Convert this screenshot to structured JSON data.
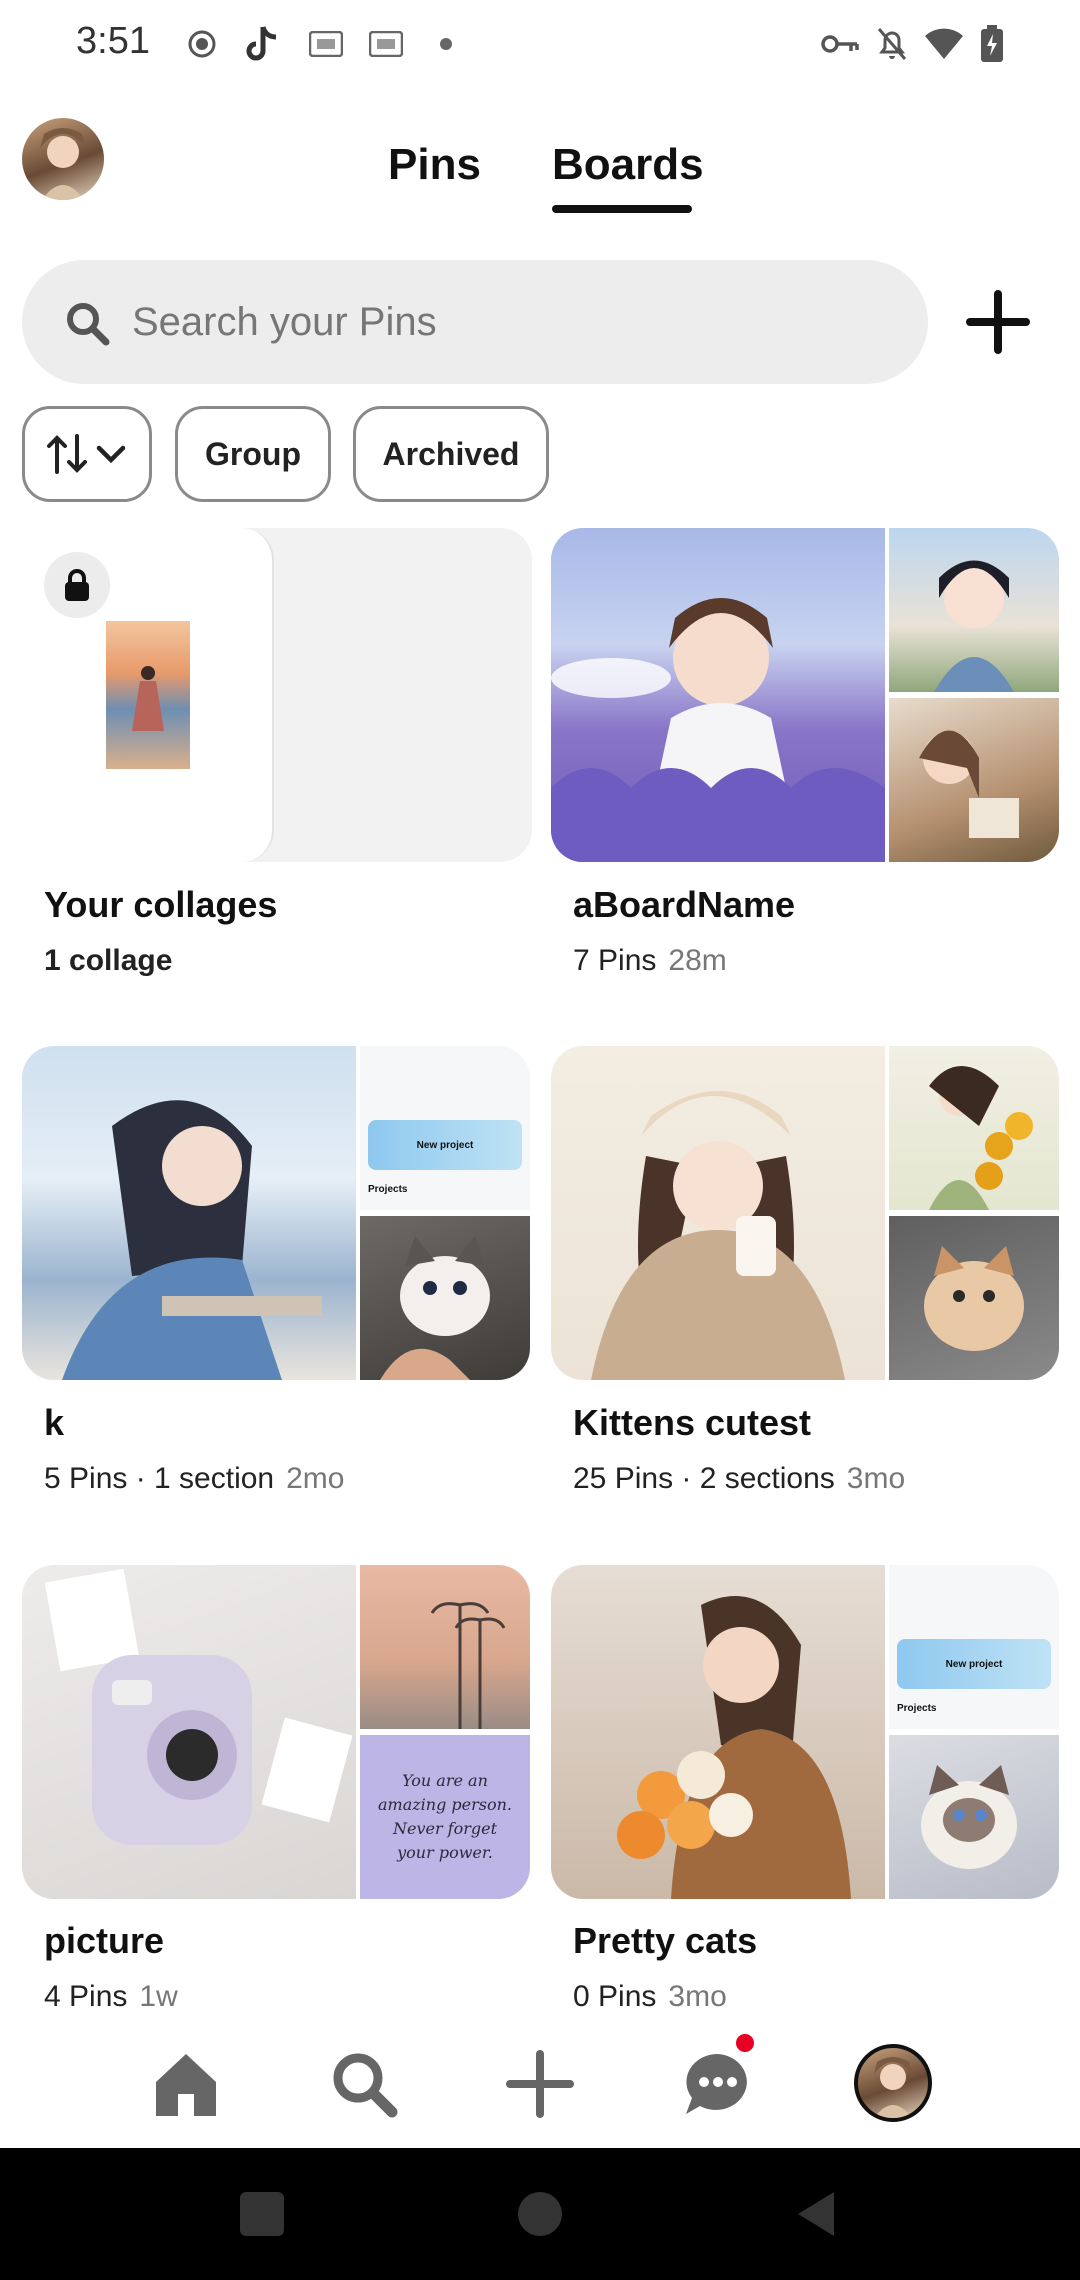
{
  "status_bar": {
    "time": "3:51",
    "left_icons": [
      "record-icon",
      "tiktok-icon",
      "iqiyi-icon",
      "iqiyi-icon",
      "dot-icon"
    ],
    "right_icons": [
      "vpn-key-icon",
      "bell-off-icon",
      "wifi-icon",
      "battery-charging-icon"
    ]
  },
  "header": {
    "tabs": [
      {
        "label": "Pins",
        "active": false
      },
      {
        "label": "Boards",
        "active": true
      }
    ]
  },
  "search": {
    "placeholder": "Search your Pins",
    "add_icon": "plus-icon"
  },
  "filters": {
    "sort_icon": "sort-arrows-icon",
    "chips": [
      "Group",
      "Archived"
    ]
  },
  "boards": [
    {
      "title": "Your collages",
      "meta": "1 collage",
      "age": "",
      "locked": true
    },
    {
      "title": "aBoardName",
      "meta": "7 Pins",
      "age": "28m"
    },
    {
      "title": "k",
      "meta": "5 Pins · 1 section",
      "age": "2mo"
    },
    {
      "title": "Kittens cutest",
      "meta": "25 Pins · 2 sections",
      "age": "3mo"
    },
    {
      "title": "picture",
      "meta": "4 Pins",
      "age": "1w"
    },
    {
      "title": "Pretty cats",
      "meta": "0 Pins",
      "age": "3mo"
    }
  ],
  "board_image_text": {
    "new_project": "New project",
    "projects": "Projects",
    "quote": "You are an amazing person. Never forget your power."
  },
  "bottom_nav": {
    "items": [
      "home-icon",
      "search-icon",
      "create-plus-icon",
      "messages-icon",
      "profile-avatar"
    ],
    "notification_dot_color": "#e60023"
  },
  "system_nav": [
    "recents-square-icon",
    "home-circle-icon",
    "back-triangle-icon"
  ]
}
